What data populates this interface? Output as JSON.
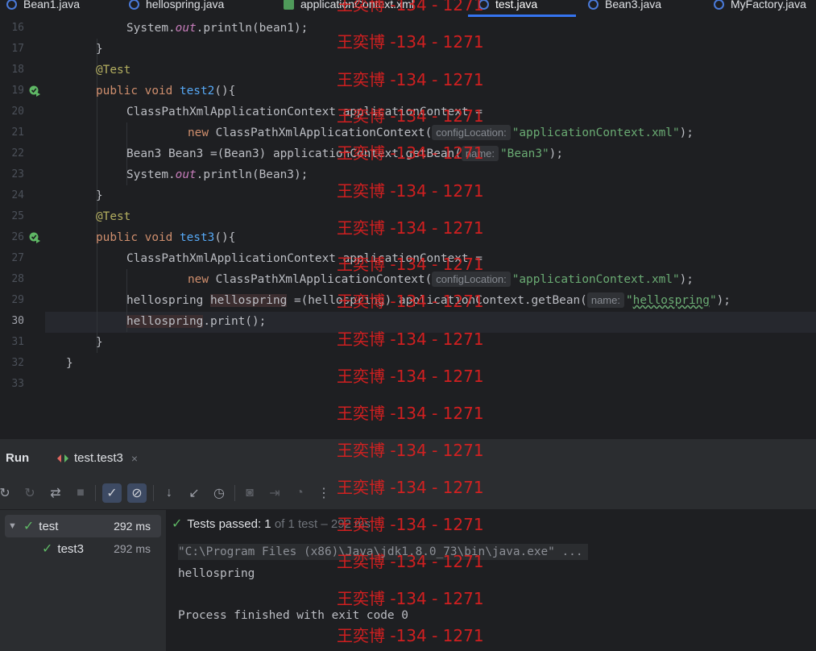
{
  "tabs": [
    "Bean1.java",
    "hellospring.java",
    "applicationContext.xml",
    "test.java",
    "Bean3.java",
    "MyFactory.java"
  ],
  "line_numbers": [
    "16",
    "17",
    "18",
    "19",
    "20",
    "21",
    "22",
    "23",
    "24",
    "25",
    "26",
    "27",
    "28",
    "29",
    "30",
    "31",
    "32",
    "33"
  ],
  "code": {
    "l16": [
      "System.",
      "out",
      ".println(bean1);"
    ],
    "l17": "}",
    "l18": "@Test",
    "l19": [
      "public ",
      "void ",
      "test2",
      "(){"
    ],
    "l20": "ClassPathXmlApplicationContext applicationContext =",
    "l21": [
      "new ",
      "ClassPathXmlApplicationContext(",
      "configLocation:",
      "\"applicationContext.xml\"",
      ");"
    ],
    "l22": [
      "Bean3 Bean3 =(Bean3) applicationContext.getBean(",
      "name:",
      "\"Bean3\"",
      ");"
    ],
    "l23": [
      "System.",
      "out",
      ".println(Bean3);"
    ],
    "l24": "}",
    "l25": "@Test",
    "l26": [
      "public ",
      "void ",
      "test3",
      "(){"
    ],
    "l27": "ClassPathXmlApplicationContext applicationContext =",
    "l28": [
      "new ",
      "ClassPathXmlApplicationContext(",
      "configLocation:",
      "\"applicationContext.xml\"",
      ");"
    ],
    "l29": [
      "hellospring ",
      "hellospring",
      " =(hellospring) applicationContext.getBean(",
      "name:",
      "\"",
      "hellospring",
      "\"",
      ");"
    ],
    "l30": [
      "hellospring",
      ".print();"
    ],
    "l31": "}",
    "l32": "}"
  },
  "run_panel": {
    "title": "Run",
    "tab_label": "test.test3",
    "tab_close": "×"
  },
  "toolbar_icons": [
    "rerun-icon",
    "rerun-failed-icon",
    "toggle-auto-test-icon",
    "stop-icon",
    "show-passed-icon",
    "show-ignored-icon",
    "sort-alpha-icon",
    "sort-duration-icon",
    "history-icon",
    "screenshot-icon",
    "import-tests-icon",
    "coverage-icon",
    "more-icon"
  ],
  "tree": [
    {
      "label": "test",
      "time": "292 ms"
    },
    {
      "label": "test3",
      "time": "292 ms"
    }
  ],
  "result": {
    "prefix": "Tests passed:",
    "count": "1",
    "suffix": "of 1 test – 292 ms"
  },
  "console": {
    "cmd": "\"C:\\Program Files (x86)\\Java\\jdk1.8.0_73\\bin\\java.exe\" ...",
    "out": "hellospring",
    "exit": "Process finished with exit code 0"
  },
  "watermark": "王奕博 -134 - 1271",
  "colors": {
    "keyword": "#cf8e6d",
    "function": "#56a8f5",
    "annotation": "#b3ae60",
    "string": "#6aab73",
    "pass": "#5fb865",
    "watermark": "#e02020"
  }
}
